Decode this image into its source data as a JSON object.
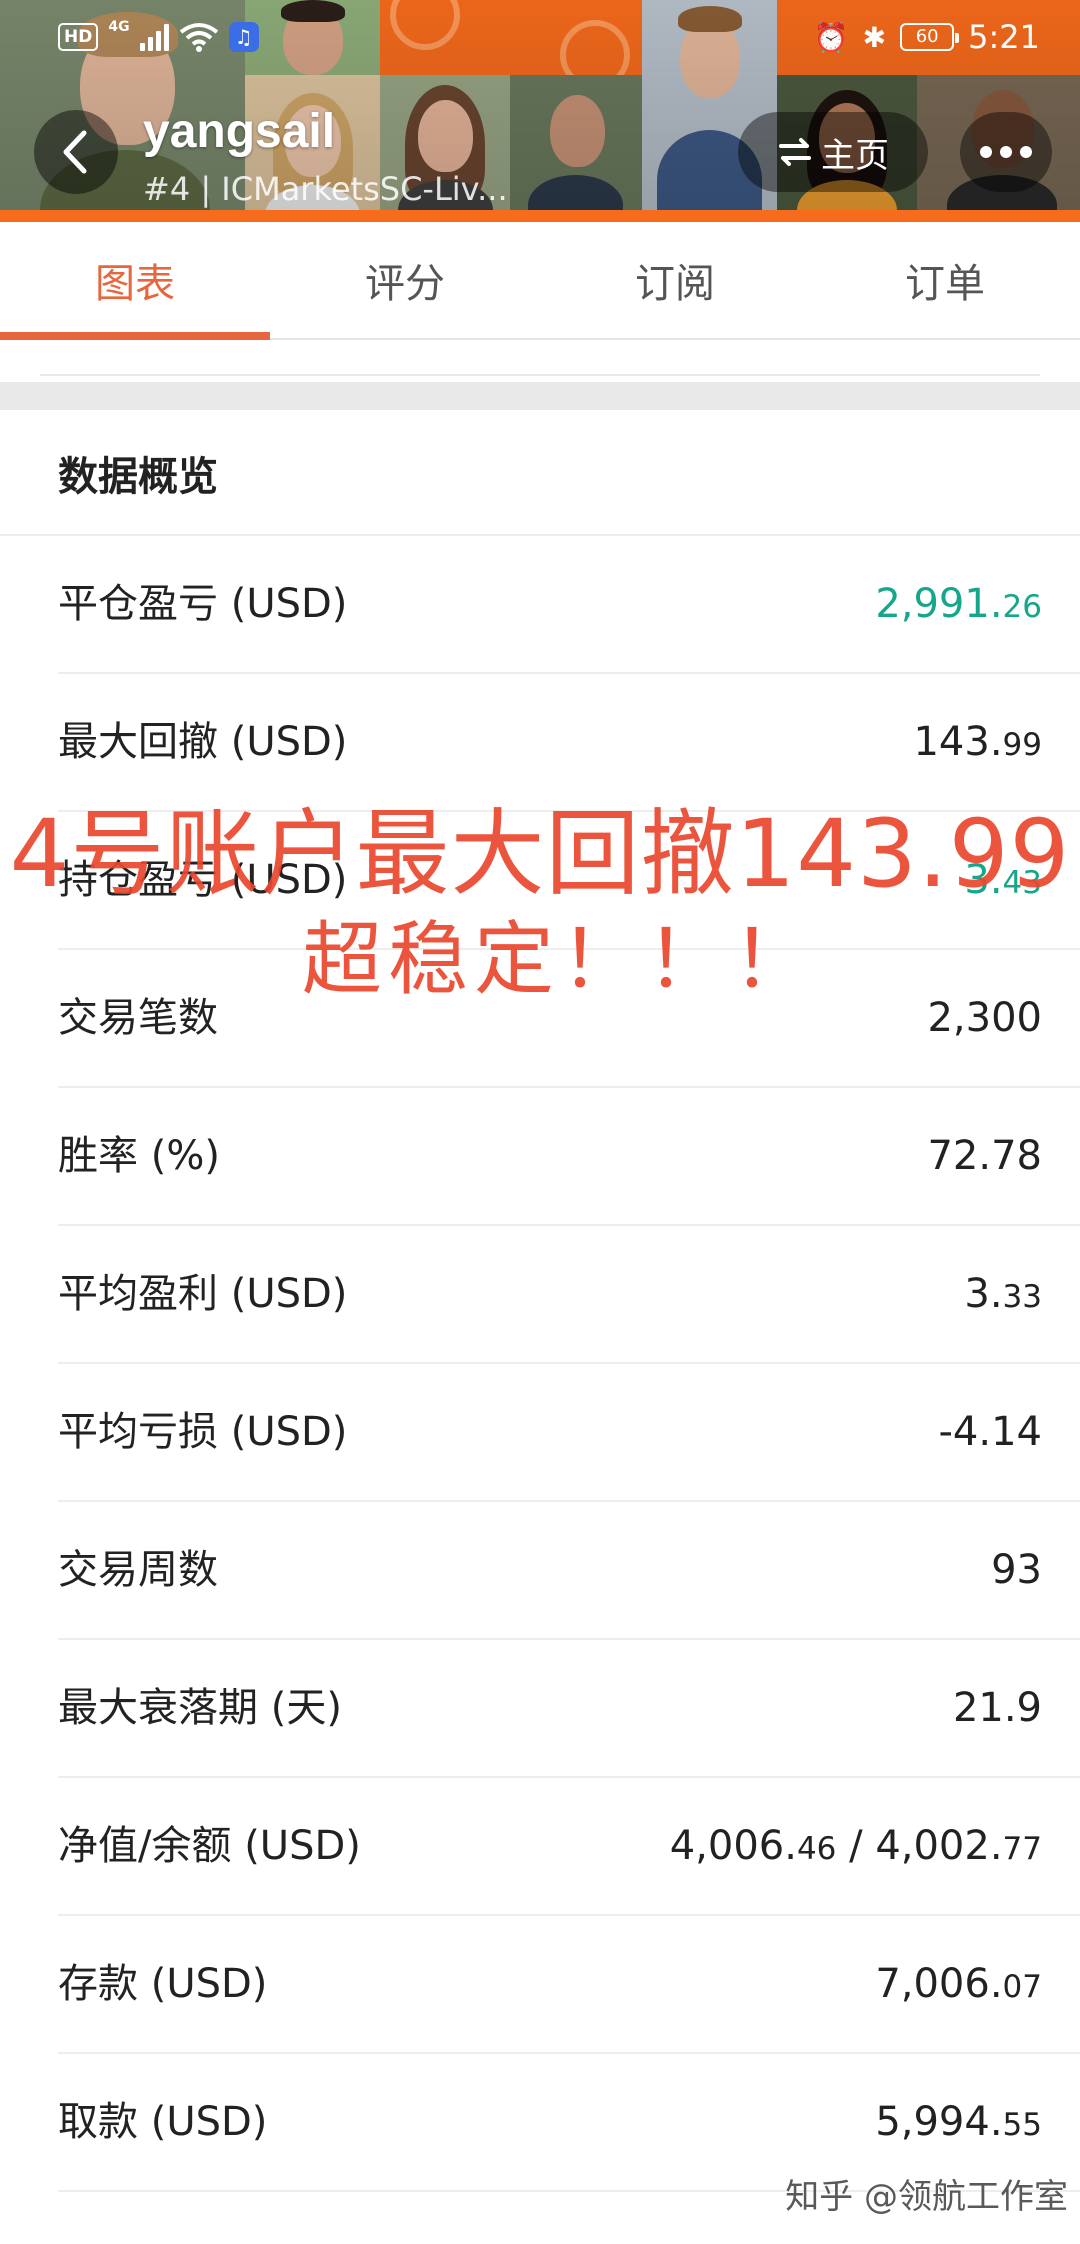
{
  "statusbar": {
    "hd": "HD",
    "network": "4G",
    "battery": "60",
    "time": "5:21"
  },
  "header": {
    "user_name": "yangsail",
    "account_line": "#4 | ICMarketsSC-Liv...",
    "home_label": "主页",
    "icons": {
      "back": "chevron-left-icon",
      "switch": "swap-arrows-icon",
      "more": "more-dots-icon"
    },
    "accent_color": "#f76b1c"
  },
  "tabs": [
    {
      "label": "图表",
      "active": true
    },
    {
      "label": "评分",
      "active": false
    },
    {
      "label": "订阅",
      "active": false
    },
    {
      "label": "订单",
      "active": false
    }
  ],
  "overview": {
    "title": "数据概览",
    "rows": [
      {
        "label": "平仓盈亏 (USD)",
        "value_int": "2,991.",
        "value_dec": "26",
        "color": "#16a68a"
      },
      {
        "label": "最大回撤 (USD)",
        "value_int": "143.",
        "value_dec": "99",
        "color": "#222222"
      },
      {
        "label": "持仓盈亏 (USD)",
        "value_int": "3.",
        "value_dec": "43",
        "color": "#16a68a"
      },
      {
        "label": "交易笔数",
        "value_int": "2,300",
        "value_dec": "",
        "color": "#222222"
      },
      {
        "label": "胜率 (%)",
        "value_int": "72.78",
        "value_dec": "",
        "color": "#222222"
      },
      {
        "label": "平均盈利 (USD)",
        "value_int": "3.",
        "value_dec": "33",
        "color": "#222222"
      },
      {
        "label": "平均亏损 (USD)",
        "value_int": "-4.14",
        "value_dec": "",
        "color": "#222222"
      },
      {
        "label": "交易周数",
        "value_int": "93",
        "value_dec": "",
        "color": "#222222"
      },
      {
        "label": "最大衰落期 (天)",
        "value_int": "21.9",
        "value_dec": "",
        "color": "#222222"
      },
      {
        "label": "净值/余额 (USD)",
        "value_int": "4,006.",
        "value_dec": "46",
        "value_int2": " / 4,002.",
        "value_dec2": "77",
        "color": "#222222"
      },
      {
        "label": "存款 (USD)",
        "value_int": "7,006.",
        "value_dec": "07",
        "color": "#222222"
      },
      {
        "label": "取款 (USD)",
        "value_int": "5,994.",
        "value_dec": "55",
        "color": "#222222"
      }
    ]
  },
  "annotation": {
    "line1": "4号账户最大回撤143.99",
    "line2": "超稳定！！！",
    "color": "#ea472d"
  },
  "watermark": "知乎 @领航工作室"
}
